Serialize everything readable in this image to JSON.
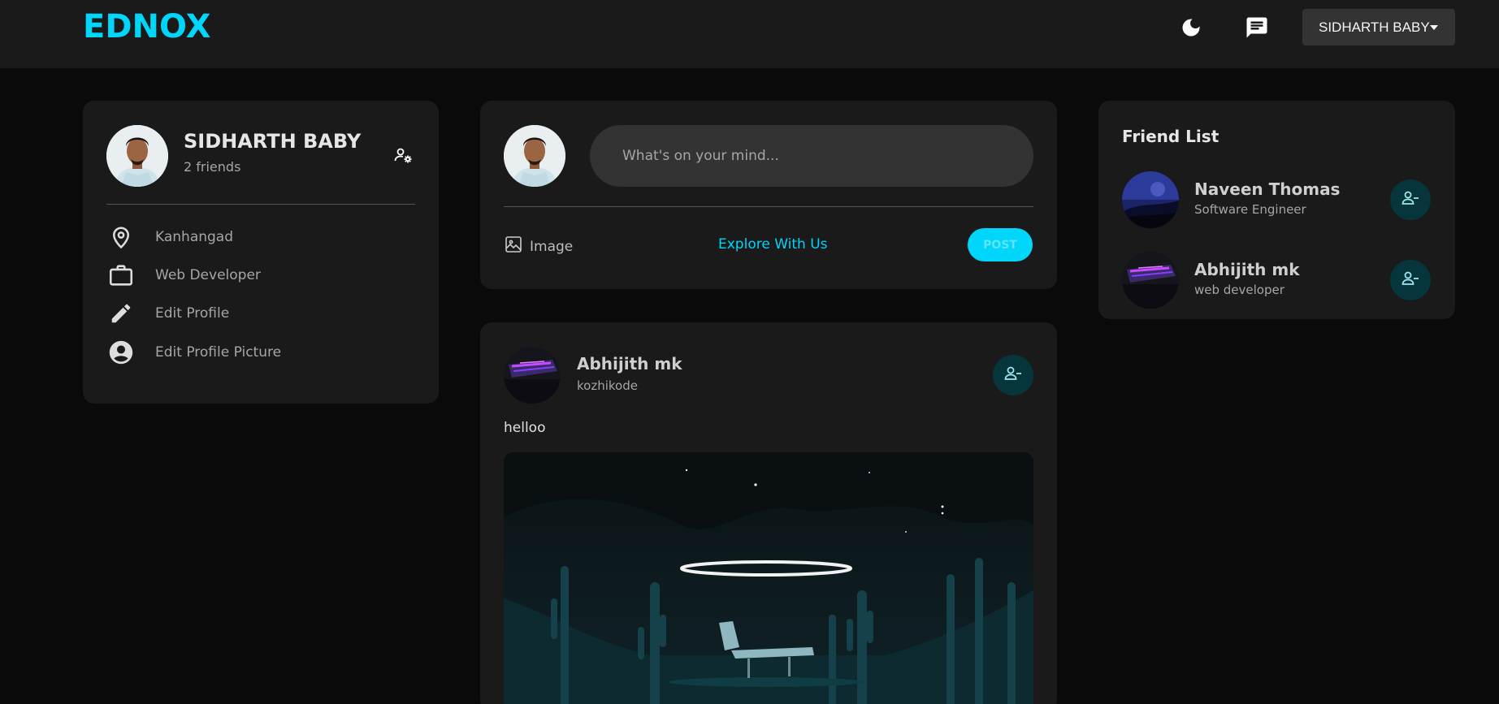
{
  "navbar": {
    "logo": "EDNOX",
    "theme_icon": "moon-icon",
    "chat_icon": "chat-icon",
    "user_menu_label": "SIDHARTH BABY"
  },
  "profile": {
    "name": "SIDHARTH BABY",
    "friends_count_text": "2 friends",
    "items": [
      {
        "icon": "location-pin-icon",
        "label": "Kanhangad"
      },
      {
        "icon": "briefcase-icon",
        "label": "Web Developer"
      },
      {
        "icon": "pencil-icon",
        "label": "Edit Profile"
      },
      {
        "icon": "account-circle-icon",
        "label": "Edit Profile Picture"
      }
    ]
  },
  "compose": {
    "placeholder": "What's on your mind...",
    "image_label": "Image",
    "explore_label": "Explore With Us",
    "post_label": "POST"
  },
  "post": {
    "author": "Abhijith mk",
    "location": "kozhikode",
    "text": "helloo"
  },
  "friend_list": {
    "title": "Friend List",
    "friends": [
      {
        "name": "Naveen Thomas",
        "occupation": "Software Engineer"
      },
      {
        "name": "Abhijith mk",
        "occupation": "web developer"
      }
    ]
  },
  "colors": {
    "accent": "#00d5fa",
    "panel": "#1a1a1a",
    "background": "#0a0a0a",
    "remove_button_bg": "#06353b"
  }
}
